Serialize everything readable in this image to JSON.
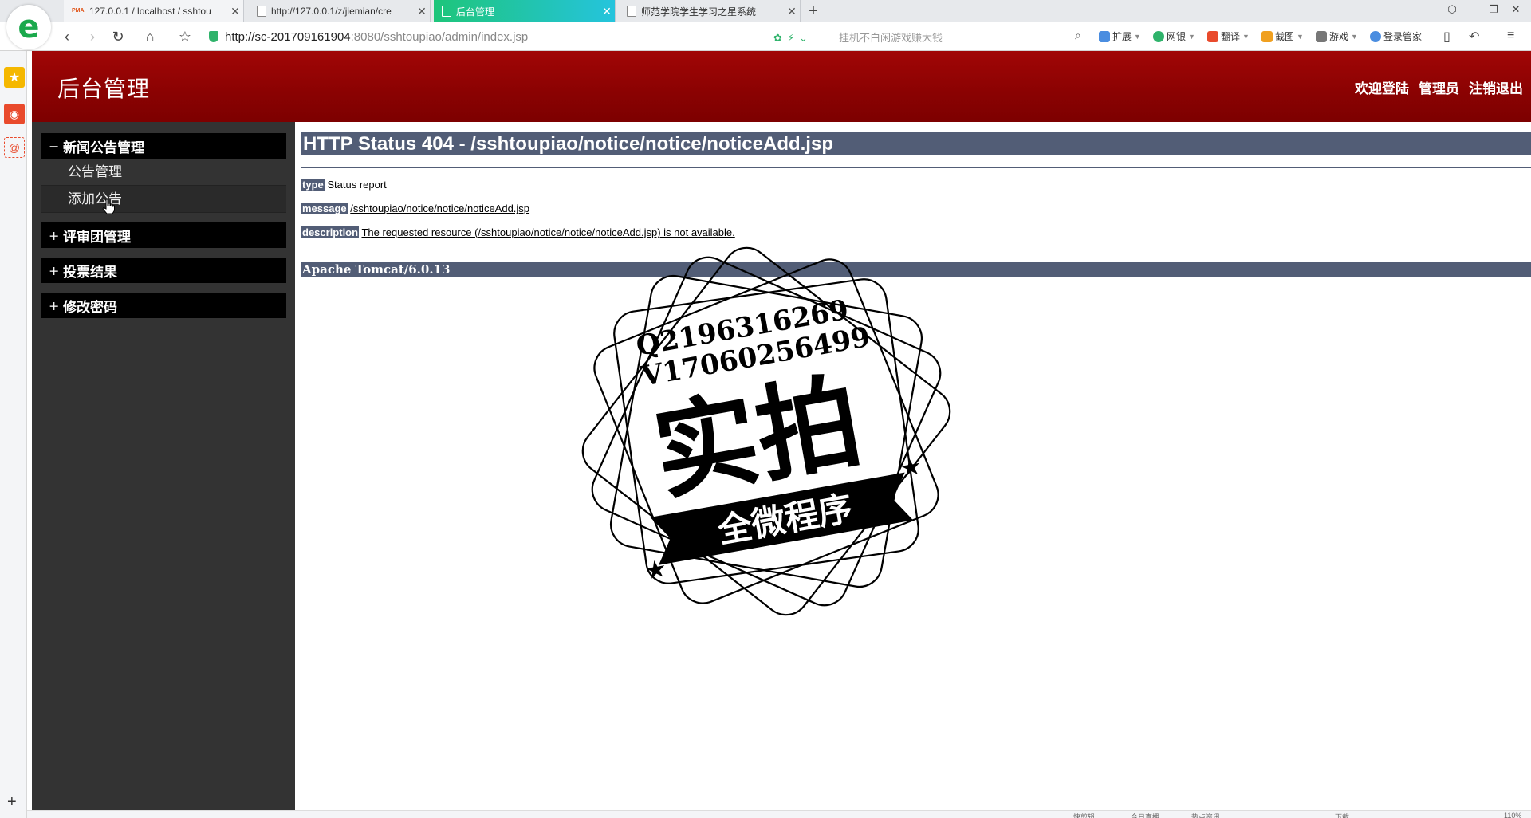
{
  "browser": {
    "logo_letter": "e",
    "tabs": [
      {
        "label": "127.0.0.1 / localhost / sshtou",
        "icon": "PMA"
      },
      {
        "label": "http://127.0.0.1/z/jiemian/cre"
      },
      {
        "label": "后台管理",
        "active": true
      },
      {
        "label": "师范学院学生学习之星系统"
      }
    ],
    "url_host": "http://sc-201709161904",
    "url_rest": ":8080/sshtoupiao/admin/index.jsp",
    "search_hint": "挂机不白闲游戏赚大钱",
    "extensions": [
      {
        "label": "扩展",
        "color": "#4a8de0"
      },
      {
        "label": "网银",
        "color": "#2fb36b"
      },
      {
        "label": "翻译",
        "color": "#e94a2c"
      },
      {
        "label": "截图",
        "color": "#f0a020"
      },
      {
        "label": "游戏",
        "color": "#777777"
      },
      {
        "label": "登录管家",
        "color": "#4a8de0"
      }
    ],
    "status_items": [
      "快剪辑",
      "今日直播",
      "热点资讯",
      "下载",
      "110%"
    ]
  },
  "app": {
    "title": "后台管理",
    "welcome": "欢迎登陆",
    "user": "管理员",
    "logout": "注销退出"
  },
  "sidebar": {
    "groups": [
      {
        "sign": "−",
        "label": "新闻公告管理",
        "items": [
          "公告管理",
          "添加公告"
        ]
      },
      {
        "sign": "+",
        "label": "评审团管理"
      },
      {
        "sign": "+",
        "label": "投票结果"
      },
      {
        "sign": "+",
        "label": "修改密码"
      }
    ]
  },
  "error_page": {
    "title": "HTTP Status 404 - /sshtoupiao/notice/notice/noticeAdd.jsp",
    "type_label": "type",
    "type_value": "Status report",
    "message_label": "message",
    "message_value": "/sshtoupiao/notice/notice/noticeAdd.jsp",
    "description_label": "description",
    "description_value": "The requested resource (/sshtoupiao/notice/notice/noticeAdd.jsp) is not available.",
    "server": "Apache Tomcat/6.0.13"
  },
  "watermark": {
    "line1": "Q2196316269",
    "line2": "V17060256499",
    "big": "实拍",
    "banner": "全微程序"
  }
}
